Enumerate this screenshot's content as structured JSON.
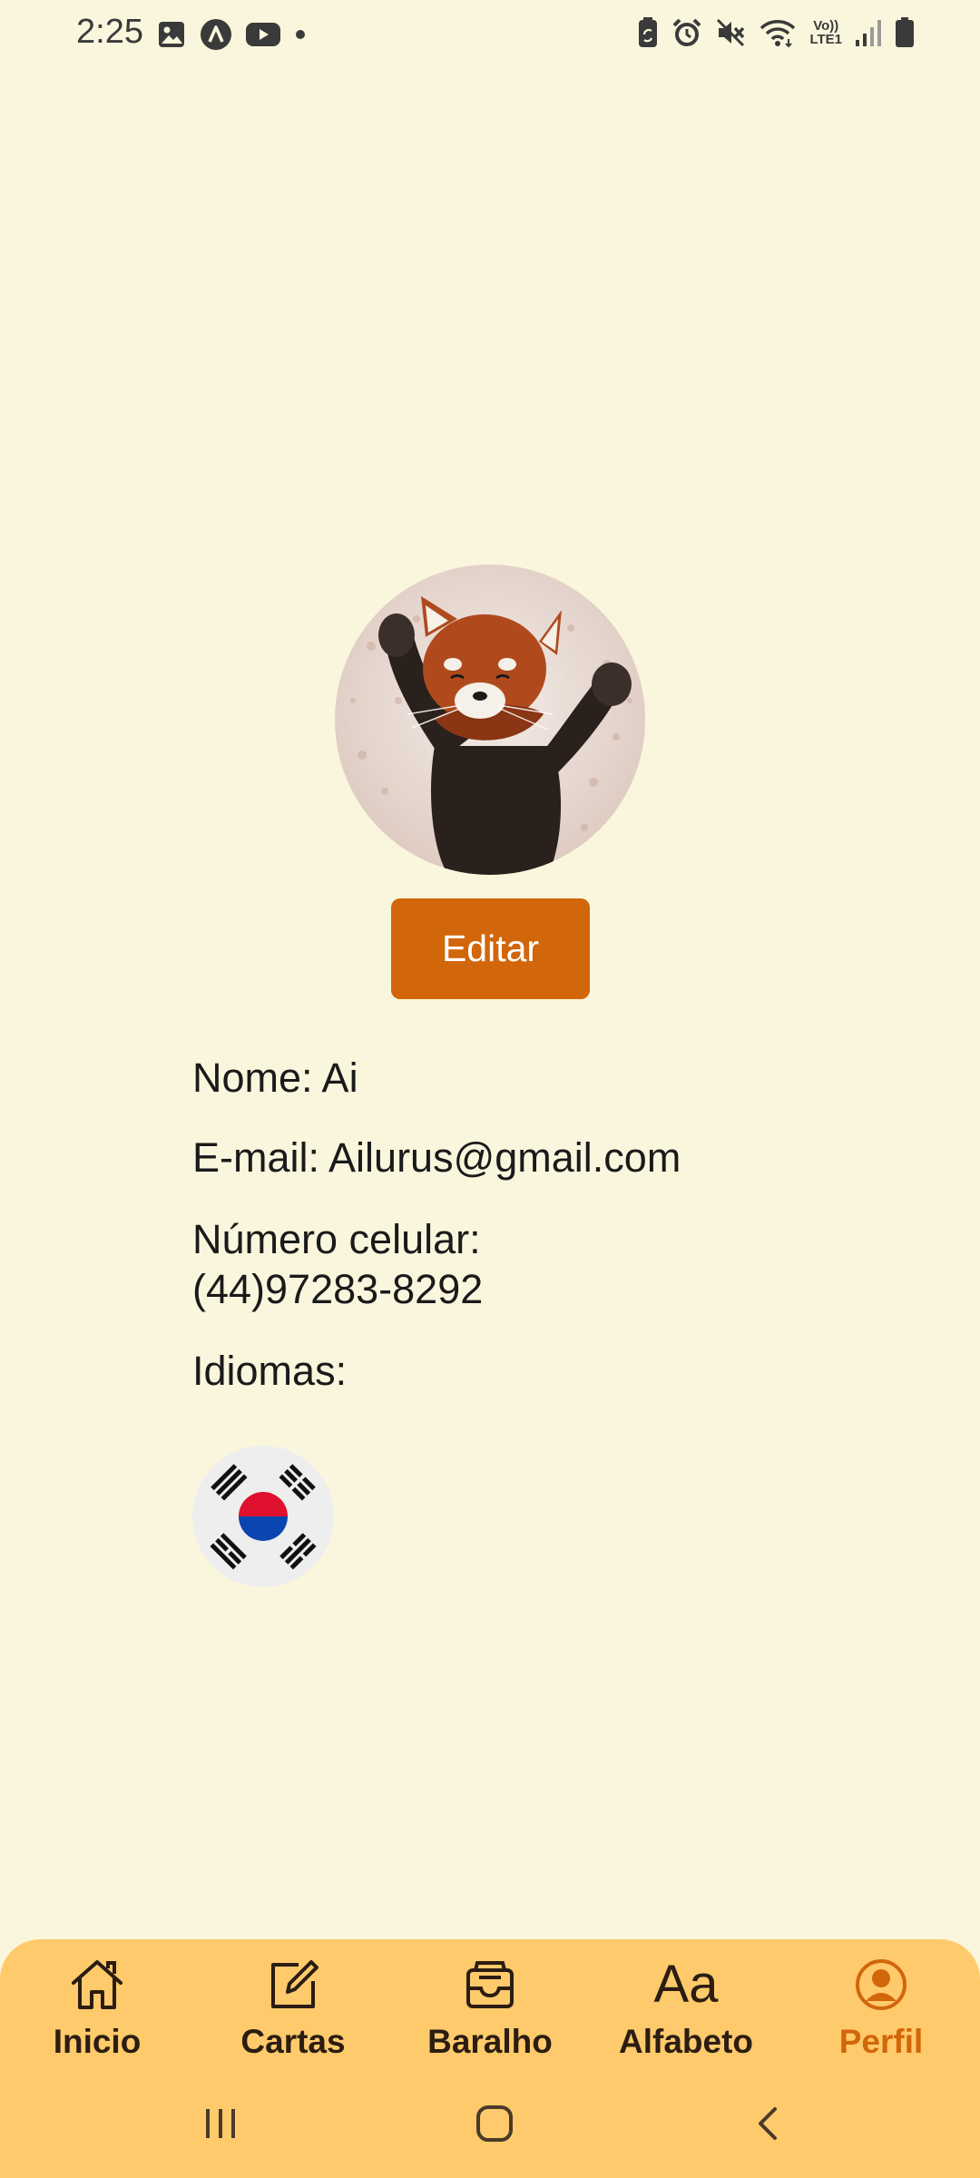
{
  "status_bar": {
    "time": "2:25",
    "left_icons": [
      "gallery-icon",
      "app-icon",
      "youtube-icon",
      "dot-icon"
    ],
    "right_icons": [
      "battery-saver-icon",
      "alarm-icon",
      "mute-icon",
      "wifi-icon",
      "volte-icon",
      "signal-icon",
      "battery-icon"
    ],
    "volte_label_top": "Vo))",
    "volte_label_bottom": "LTE1"
  },
  "profile": {
    "avatar_alt": "red panda avatar",
    "edit_label": "Editar",
    "name_line": "Nome: Ai",
    "email_line": "E-mail: Ailurus@gmail.com",
    "phone_label": "Número celular:",
    "phone_value": "(44)97283-8292",
    "languages_label": "Idiomas:",
    "languages": [
      "korean-flag-icon"
    ]
  },
  "bottom_nav": {
    "items": [
      {
        "label": "Inicio",
        "icon": "home-icon",
        "active": false
      },
      {
        "label": "Cartas",
        "icon": "edit-icon",
        "active": false
      },
      {
        "label": "Baralho",
        "icon": "inbox-icon",
        "active": false
      },
      {
        "label": "Alfabeto",
        "icon": "font-icon",
        "active": false
      },
      {
        "label": "Perfil",
        "icon": "user-circle-icon",
        "active": true
      }
    ],
    "alfabeto_glyph": "Aa"
  },
  "system_nav": [
    "recent-apps-icon",
    "home-button-icon",
    "back-icon"
  ],
  "colors": {
    "background": "#faf6dd",
    "accent": "#d2660a",
    "nav_background": "#ffca6b",
    "nav_text": "#2b1d12"
  }
}
